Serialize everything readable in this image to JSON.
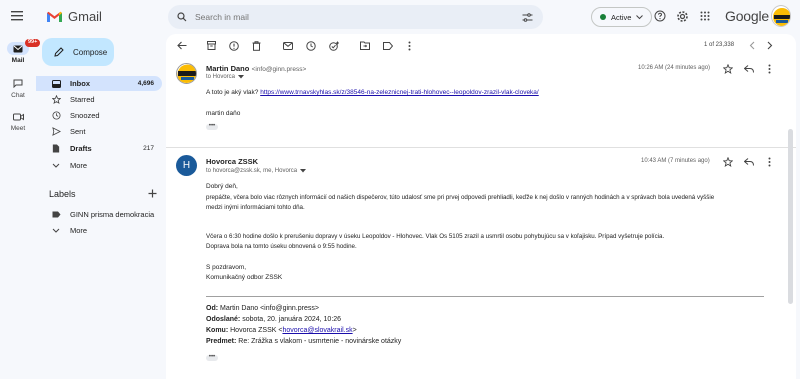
{
  "app": {
    "name": "Gmail",
    "search_placeholder": "Search in mail",
    "status": "Active",
    "google_logo": "Google"
  },
  "rail": {
    "mail_label": "Mail",
    "mail_badge": "99+",
    "chat_label": "Chat",
    "meet_label": "Meet"
  },
  "sidebar": {
    "compose": "Compose",
    "items": [
      {
        "label": "Inbox",
        "count": "4,696"
      },
      {
        "label": "Starred",
        "count": ""
      },
      {
        "label": "Snoozed",
        "count": ""
      },
      {
        "label": "Sent",
        "count": ""
      },
      {
        "label": "Drafts",
        "count": "217"
      },
      {
        "label": "More",
        "count": ""
      }
    ],
    "labels_title": "Labels",
    "labels": [
      {
        "label": "GINN prisma demokracia"
      },
      {
        "label": "More"
      }
    ]
  },
  "toolbar": {
    "pager": "1 of 23,338"
  },
  "messages": [
    {
      "sender": "Martin Dano",
      "email": "<info@ginn.press>",
      "to": "to Hovorca",
      "time": "10:26 AM (24 minutes ago)",
      "line1_prefix": "A toto je aký vlak?",
      "link": "https://www.trnavskyhlas.sk/z/38546-na-zeleznicnej-trati-hlohovec--leopoldov-zrazil-vlak-cloveka/",
      "signature": "martin daňo"
    },
    {
      "sender": "Hovorca ZSSK",
      "email": "",
      "avatar_letter": "H",
      "to": "to hovorca@zssk.sk, me, Hovorca",
      "time": "10:43 AM (7 minutes ago)",
      "greeting": "Dobrý deň,",
      "para1_line1": "prepáčte, včera bolo viac rôznych informácií od našich dispečerov, túto udalosť sme pri prvej odpovedi prehliadli, keďže k nej došlo v ranných hodinách a v správach bola uvedená vyššie",
      "para1_line2": "medzi inými informáciami tohto dňa.",
      "para2_line1": "Včera o 6:30 hodine došlo k prerušeniu dopravy v úseku Leopoldov - Hlohovec. Vlak Os 5105 zrazil a usmrtil osobu pohybujúcu sa v koľajisku.  Prípad vyšetruje polícia.",
      "para2_line2": "Doprava bola na tomto úseku obnovená o 9:55 hodine.",
      "closing": "S pozdravom,",
      "dept": "Komunikačný odbor ZSSK",
      "quote": {
        "od_label": "Od:",
        "od_value": "Martin Dano <info@ginn.press>",
        "odoslane_label": "Odoslané:",
        "odoslane_value": "sobota, 20. januára 2024, 10:26",
        "komu_label": "Komu:",
        "komu_value_prefix": "Hovorca ZSSK <",
        "komu_link": "hovorca@slovakrail.sk",
        "komu_value_suffix": ">",
        "predmet_label": "Predmet:",
        "predmet_value": "Re: Zrážka s vlakom - usmrtenie - novinárske otázky"
      }
    }
  ],
  "colors": {
    "accent": "#0b57d0",
    "compose_bg": "#c2e7ff",
    "active_nav": "#d3e3fd",
    "badge": "#d93025",
    "avatar_h": "#1a5a9a",
    "active_dot": "#188038"
  }
}
